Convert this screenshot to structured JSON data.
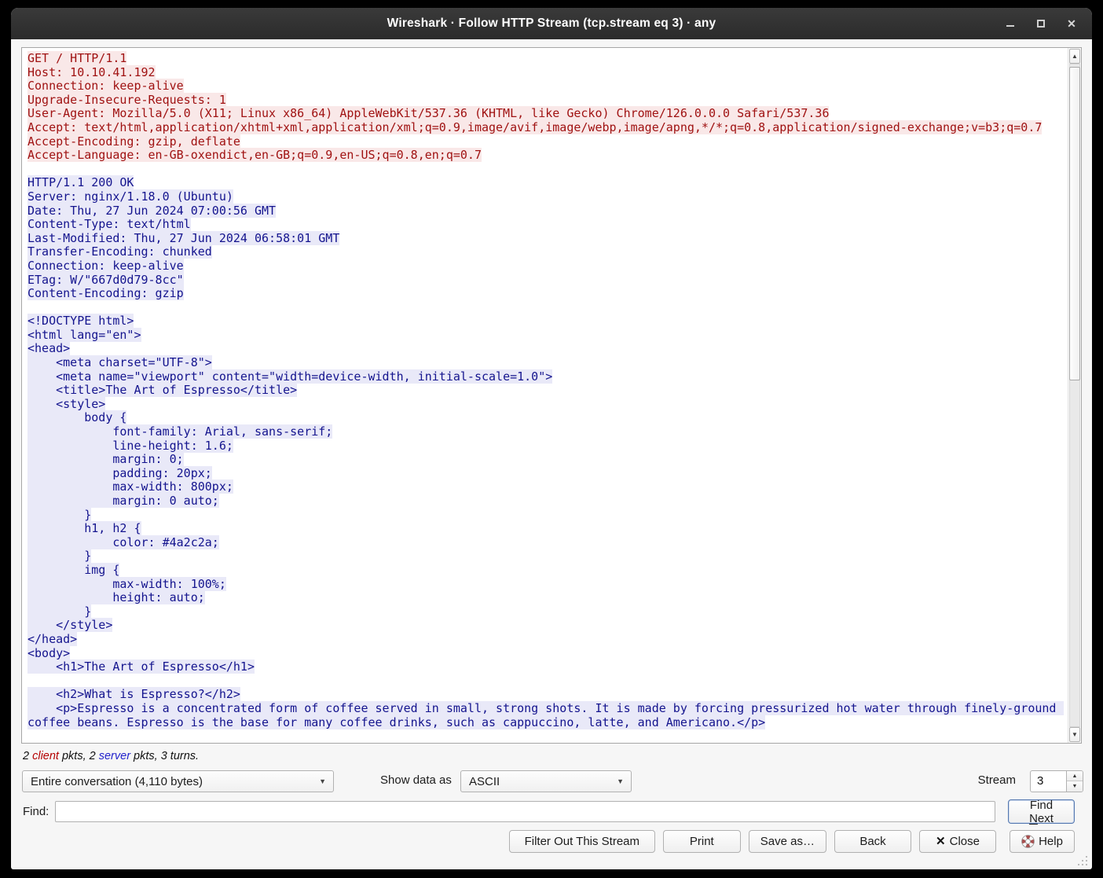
{
  "window": {
    "title": "Wireshark · Follow HTTP Stream (tcp.stream eq 3) · any"
  },
  "stream": {
    "client_color": "#a01212",
    "client_bg": "#f9e8e8",
    "server_color": "#14148e",
    "server_bg": "#e9e9f8",
    "client_text": "GET / HTTP/1.1\nHost: 10.10.41.192\nConnection: keep-alive\nUpgrade-Insecure-Requests: 1\nUser-Agent: Mozilla/5.0 (X11; Linux x86_64) AppleWebKit/537.36 (KHTML, like Gecko) Chrome/126.0.0.0 Safari/537.36\nAccept: text/html,application/xhtml+xml,application/xml;q=0.9,image/avif,image/webp,image/apng,*/*;q=0.8,application/signed-exchange;v=b3;q=0.7\nAccept-Encoding: gzip, deflate\nAccept-Language: en-GB-oxendict,en-GB;q=0.9,en-US;q=0.8,en;q=0.7",
    "gap": "\n\n",
    "server_text": "HTTP/1.1 200 OK\nServer: nginx/1.18.0 (Ubuntu)\nDate: Thu, 27 Jun 2024 07:00:56 GMT\nContent-Type: text/html\nLast-Modified: Thu, 27 Jun 2024 06:58:01 GMT\nTransfer-Encoding: chunked\nConnection: keep-alive\nETag: W/\"667d0d79-8cc\"\nContent-Encoding: gzip\n\n<!DOCTYPE html>\n<html lang=\"en\">\n<head>\n    <meta charset=\"UTF-8\">\n    <meta name=\"viewport\" content=\"width=device-width, initial-scale=1.0\">\n    <title>The Art of Espresso</title>\n    <style>\n        body {\n            font-family: Arial, sans-serif;\n            line-height: 1.6;\n            margin: 0;\n            padding: 20px;\n            max-width: 800px;\n            margin: 0 auto;\n        }\n        h1, h2 {\n            color: #4a2c2a;\n        }\n        img {\n            max-width: 100%;\n            height: auto;\n        }\n    </style>\n</head>\n<body>\n    <h1>The Art of Espresso</h1>\n\n    <h2>What is Espresso?</h2>\n    <p>Espresso is a concentrated form of coffee served in small, strong shots. It is made by forcing pressurized hot water through finely-ground coffee beans. Espresso is the base for many coffee drinks, such as cappuccino, latte, and Americano.</p>"
  },
  "stats": {
    "client_color": "#b40000",
    "server_color": "#2222cc",
    "prefix": "2 ",
    "client_word": "client",
    "mid": " pkts, 2 ",
    "server_word": "server",
    "tail": " pkts, 3 turns."
  },
  "controls": {
    "conversation_value": "Entire conversation (4,110 bytes)",
    "show_data_as_label": "Show data as",
    "show_data_as_value": "ASCII",
    "stream_label": "Stream",
    "stream_value": "3"
  },
  "find": {
    "label": "Find:",
    "value": "",
    "button_pre": "Find ",
    "button_mnemonic": "N",
    "button_post": "ext"
  },
  "footer": {
    "filter_label": "Filter Out This Stream",
    "print_label": "Print",
    "save_as_label": "Save as…",
    "back_label": "Back",
    "close_label": "Close",
    "help_label": "Help"
  },
  "icons": {
    "window_close": "✕",
    "button_close": "✕",
    "combo_arrow": "▼",
    "spin_up": "▲",
    "spin_down": "▼",
    "scroll_up": "▲",
    "scroll_down": "▼"
  }
}
